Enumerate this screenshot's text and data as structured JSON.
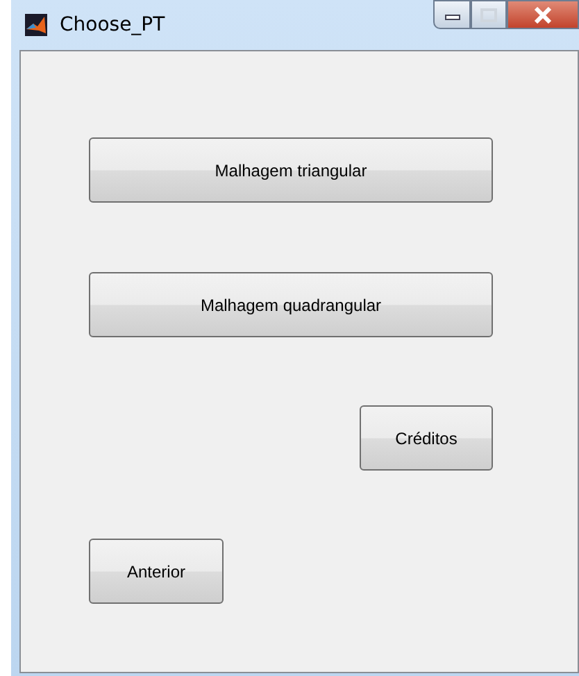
{
  "window": {
    "title": "Choose_PT"
  },
  "buttons": [
    {
      "label": "Malhagem triangular",
      "kind": "wide"
    },
    {
      "label": "Malhagem quadrangular",
      "kind": "wide"
    },
    {
      "label": "Créditos",
      "kind": "right"
    },
    {
      "label": "Anterior",
      "kind": "left"
    }
  ]
}
